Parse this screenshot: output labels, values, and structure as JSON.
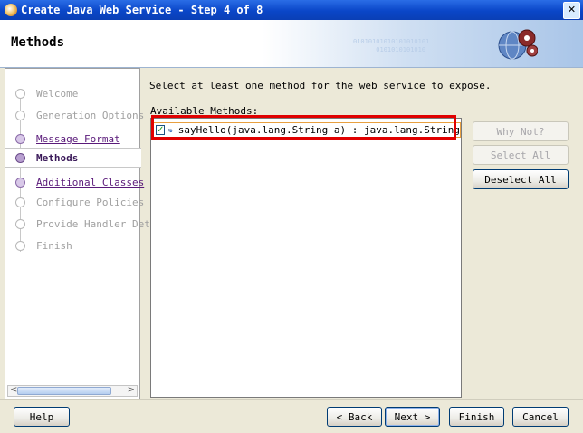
{
  "window": {
    "title": "Create Java Web Service - Step 4 of 8",
    "close_glyph": "✕"
  },
  "header": {
    "title": "Methods",
    "decor_binary": "01010101010101010101\n      0101010101010"
  },
  "sidebar": {
    "steps": [
      {
        "label": "Welcome",
        "state": "disabled"
      },
      {
        "label": "Generation Options",
        "state": "disabled"
      },
      {
        "label": "Message Format",
        "state": "link"
      },
      {
        "label": "Methods",
        "state": "current"
      },
      {
        "label": "Additional Classes",
        "state": "link"
      },
      {
        "label": "Configure Policies",
        "state": "disabled"
      },
      {
        "label": "Provide Handler Det",
        "state": "disabled"
      },
      {
        "label": "Finish",
        "state": "disabled"
      }
    ],
    "scroll_left": "<",
    "scroll_right": ">"
  },
  "main": {
    "description": "Select at least one method for the web service to expose.",
    "list_label": "Available Methods:",
    "methods": [
      {
        "name": "sayHello(java.lang.String a) : java.lang.String",
        "checked": true
      }
    ]
  },
  "side_buttons": {
    "why_not": "Why Not?",
    "select_all": "Select All",
    "deselect_all": "Deselect All"
  },
  "footer": {
    "help": "Help",
    "back": "< Back",
    "next": "Next >",
    "finish": "Finish",
    "cancel": "Cancel"
  },
  "colors": {
    "title_bar": "#0a46c8",
    "highlight": "#e00000",
    "link": "#5a1a7a"
  }
}
